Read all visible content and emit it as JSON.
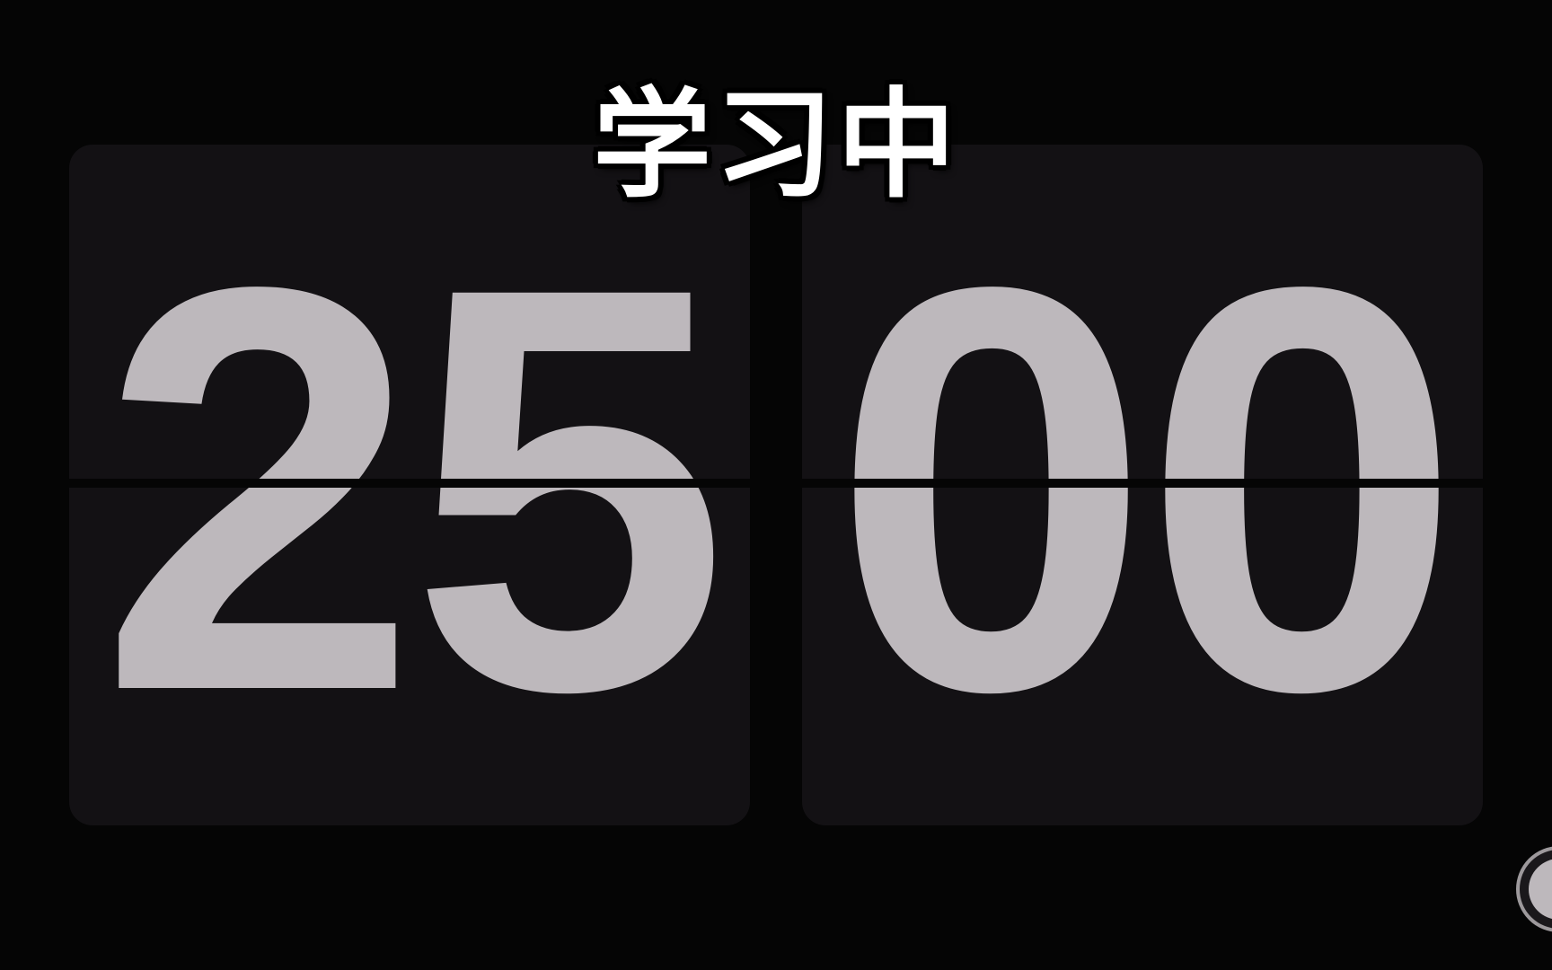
{
  "status": {
    "label": "学习中"
  },
  "timer": {
    "minutes": "25",
    "seconds": "00"
  },
  "colors": {
    "background": "#050505",
    "card": "#131114",
    "digit": "#bdb8bc",
    "status_text": "#ffffff"
  },
  "icons": {
    "corner_control": "circle-button-icon"
  }
}
